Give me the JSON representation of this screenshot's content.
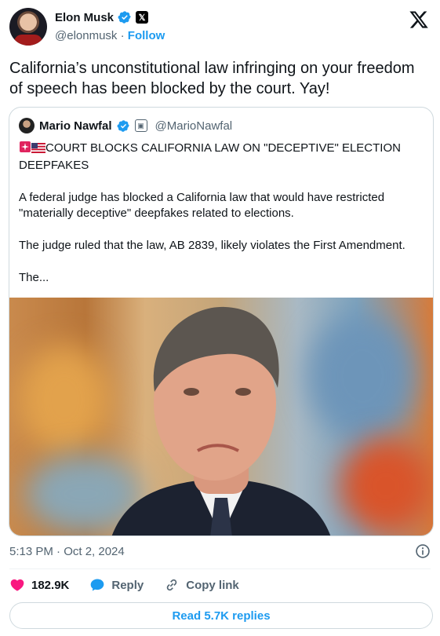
{
  "author": {
    "display_name": "Elon Musk",
    "handle": "@elonmusk",
    "separator": "·",
    "follow_label": "Follow"
  },
  "tweet": {
    "text": "California’s unconstitutional law infringing on your freedom of speech has been blocked by the court. Yay!",
    "timestamp": "5:13 PM · Oct 2, 2024"
  },
  "quoted": {
    "display_name": "Mario Nawfal",
    "handle": "@MarioNawfal",
    "headline": "COURT BLOCKS CALIFORNIA LAW ON \"DECEPTIVE\" ELECTION DEEPFAKES",
    "paragraph_1": "A federal judge has blocked a California law that would have restricted \"materially deceptive\" deepfakes related to elections.",
    "paragraph_2": "The judge ruled that the law, AB 2839, likely violates the First Amendment.",
    "paragraph_3": "The..."
  },
  "actions": {
    "likes": "182.9K",
    "reply_label": "Reply",
    "copy_link_label": "Copy link"
  },
  "read_replies_label": "Read 5.7K replies",
  "icons": {
    "verified": "verified-badge-icon",
    "x_badge": "x-affiliate-badge-icon",
    "x_logo": "x-logo-icon",
    "info": "info-icon",
    "like": "heart-icon",
    "reply": "speech-bubble-icon",
    "link": "link-icon"
  },
  "colors": {
    "accent": "#1d9bf0",
    "like": "#f91880",
    "text": "#0f1419",
    "muted": "#536471",
    "border": "#cfd9de"
  }
}
